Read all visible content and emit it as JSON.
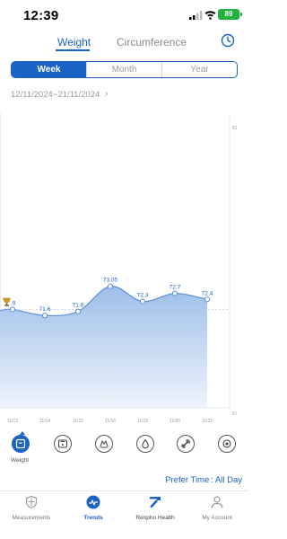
{
  "status_bar": {
    "time": "12:39",
    "battery": "89"
  },
  "top_tabs": [
    {
      "label": "Weight",
      "active": true
    },
    {
      "label": "Circumference",
      "active": false
    }
  ],
  "period_tabs": [
    {
      "label": "Week",
      "active": true
    },
    {
      "label": "Month",
      "active": false
    },
    {
      "label": "Year",
      "active": false
    }
  ],
  "date_range": "12/11/2024~21/11/2024",
  "chart_data": {
    "type": "area",
    "categories": [
      "11/13",
      "11/14",
      "11/15",
      "11/16",
      "11/19",
      "11/20",
      "11/21"
    ],
    "values": [
      71.9,
      71.6,
      71.8,
      73.05,
      72.3,
      72.7,
      72.4
    ],
    "value_labels": [
      ".9",
      "71.6",
      "71.8",
      "73.05",
      "72.3",
      "72.7",
      "72.4"
    ],
    "y_axis": {
      "ticks": [
        "81",
        "67"
      ],
      "min": 67,
      "max": 81
    },
    "reference_line": 71.9,
    "first_point_badge": "trophy-icon",
    "colors": {
      "line": "#5b8fd6",
      "fill_top": "#9dbfe9",
      "fill_bottom": "#eef4fc",
      "point": "#ffffff"
    }
  },
  "metrics": [
    {
      "icon": "scale-icon",
      "label": "Weight",
      "active": true
    },
    {
      "icon": "body-fat-scale-icon",
      "label": "",
      "active": false
    },
    {
      "icon": "muscle-icon",
      "label": "",
      "active": false
    },
    {
      "icon": "water-drop-icon",
      "label": "",
      "active": false
    },
    {
      "icon": "bone-icon",
      "label": "",
      "active": false
    },
    {
      "icon": "bmr-icon",
      "label": "",
      "active": false
    }
  ],
  "prefer_time": {
    "label": "Prefer Time",
    "separator": ":",
    "value": "All Day"
  },
  "bottom_nav": [
    {
      "icon": "shield-icon",
      "label": "Measurements",
      "active": false
    },
    {
      "icon": "trends-icon",
      "label": "Trends",
      "active": true
    },
    {
      "icon": "renpho-logo-icon",
      "label": "Renpho Health",
      "active": false
    },
    {
      "icon": "user-icon",
      "label": "My Account",
      "active": false
    }
  ],
  "colors": {
    "accent": "#1a63c4",
    "muted": "#9a9a9a"
  }
}
